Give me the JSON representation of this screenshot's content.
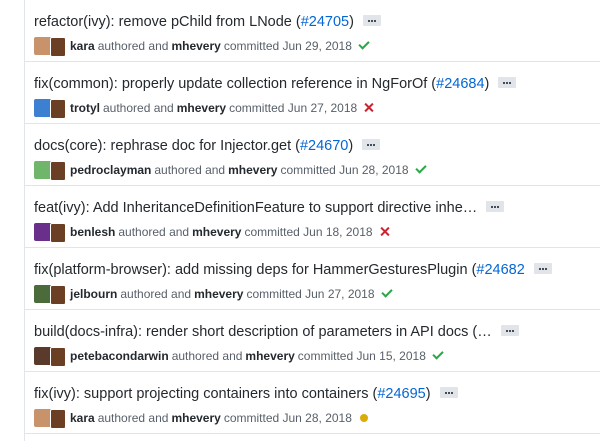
{
  "colors": {
    "link": "#0366d6",
    "success": "#28a745",
    "failure": "#cb2431",
    "pending": "#dbab09",
    "border": "#e1e4e8"
  },
  "commits": [
    {
      "title": "refactor(ivy): remove pChild from LNode (",
      "issue": "#24705",
      "title_end": ")",
      "author": "kara",
      "authored_text": "authored and",
      "committer": "mhevery",
      "committed_text": "committed Jun 29, 2018",
      "status": "check-icon",
      "avatar_color": "#c8936a"
    },
    {
      "title": "fix(common): properly update collection reference in NgForOf (",
      "issue": "#24684",
      "title_end": ")",
      "author": "trotyl",
      "authored_text": "authored and",
      "committer": "mhevery",
      "committed_text": "committed Jun 27, 2018",
      "status": "x-icon",
      "avatar_color": "#3d7fd1"
    },
    {
      "title": "docs(core): rephrase doc for Injector.get (",
      "issue": "#24670",
      "title_end": ")",
      "author": "pedroclayman",
      "authored_text": "authored and",
      "committer": "mhevery",
      "committed_text": "committed Jun 28, 2018",
      "status": "check-icon",
      "avatar_color": "#6fb56a"
    },
    {
      "title": "feat(ivy): Add InheritanceDefinitionFeature to support directive inhe…",
      "issue": "",
      "title_end": "",
      "author": "benlesh",
      "authored_text": "authored and",
      "committer": "mhevery",
      "committed_text": "committed Jun 18, 2018",
      "status": "x-icon",
      "avatar_color": "#6a2f8a"
    },
    {
      "title": "fix(platform-browser): add missing deps for HammerGesturesPlugin (",
      "issue": "#24682",
      "title_end": "",
      "author": "jelbourn",
      "authored_text": "authored and",
      "committer": "mhevery",
      "committed_text": "committed Jun 27, 2018",
      "status": "check-icon",
      "avatar_color": "#4b6b3a"
    },
    {
      "title": "build(docs-infra): render short description of parameters in API docs (…",
      "issue": "",
      "title_end": "",
      "author": "petebacondarwin",
      "authored_text": "authored and",
      "committer": "mhevery",
      "committed_text": "committed Jun 15, 2018",
      "status": "check-icon",
      "avatar_color": "#5a3a2a"
    },
    {
      "title": "fix(ivy): support projecting containers into containers (",
      "issue": "#24695",
      "title_end": ")",
      "author": "kara",
      "authored_text": "authored and",
      "committer": "mhevery",
      "committed_text": "committed Jun 28, 2018",
      "status": "dot-icon",
      "avatar_color": "#c8936a"
    }
  ]
}
